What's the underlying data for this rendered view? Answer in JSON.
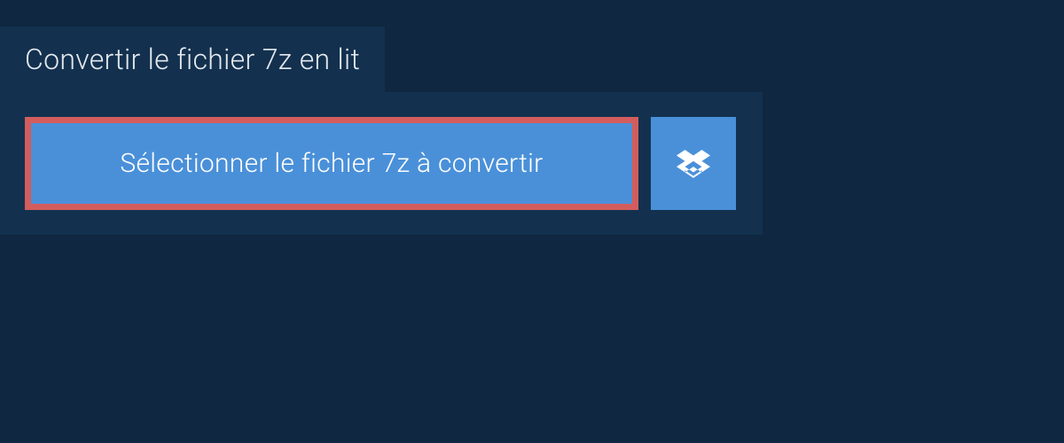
{
  "tab": {
    "title": "Convertir le fichier 7z en lit"
  },
  "actions": {
    "select_file_label": "Sélectionner le fichier 7z à convertir"
  }
}
